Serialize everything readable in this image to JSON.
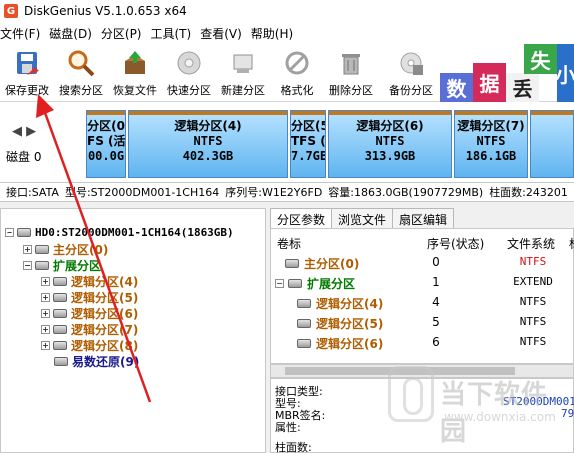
{
  "window": {
    "title": "DiskGenius V5.1.0.653 x64",
    "app_icon_letter": "G"
  },
  "menu": [
    "文件(F)",
    "磁盘(D)",
    "分区(P)",
    "工具(T)",
    "查看(V)",
    "帮助(H)"
  ],
  "toolbar": [
    {
      "label": "保存更改",
      "icon": "save-disk-icon"
    },
    {
      "label": "搜索分区",
      "icon": "magnifier-icon"
    },
    {
      "label": "恢复文件",
      "icon": "recover-box-icon"
    },
    {
      "label": "快速分区",
      "icon": "quick-partition-icon"
    },
    {
      "label": "新建分区",
      "icon": "new-partition-icon"
    },
    {
      "label": "格式化",
      "icon": "format-icon"
    },
    {
      "label": "删除分区",
      "icon": "trash-icon"
    },
    {
      "label": "备份分区",
      "icon": "backup-icon"
    }
  ],
  "ad_tiles": [
    {
      "text": "数",
      "bg": "#5a6fd6"
    },
    {
      "text": "据",
      "bg": "#d42a5a"
    },
    {
      "text": "丢",
      "bg": "#f2f2f2"
    },
    {
      "text": "失",
      "bg": "#3aa64a"
    },
    {
      "text": "小",
      "bg": "#2a6fc9"
    }
  ],
  "disk_map": {
    "disk_label": "磁盘 0",
    "partitions": [
      {
        "line1": "分区(0",
        "line2": "FS (活",
        "line3": "00.0G"
      },
      {
        "line1": "逻辑分区(4)",
        "line2": "NTFS",
        "line3": "402.3GB"
      },
      {
        "line1": "分区(5",
        "line2": "TFS (隐",
        "line3": "7.7GE"
      },
      {
        "line1": "逻辑分区(6)",
        "line2": "NTFS",
        "line3": "313.9GB"
      },
      {
        "line1": "逻辑分区(7)",
        "line2": "NTFS",
        "line3": "186.1GB"
      },
      {
        "line1": "",
        "line2": "",
        "line3": ""
      }
    ]
  },
  "info_bar": {
    "interface": "接口:SATA",
    "model": "型号:ST2000DM001-1CH164",
    "serial": "序列号:W1E2Y6FD",
    "capacity": "容量:1863.0GB(1907729MB)",
    "cylinders": "柱面数:243201"
  },
  "tree": {
    "root": "HD0:ST2000DM001-1CH164(1863GB)",
    "items": [
      {
        "label": "主分区(0)",
        "style": "brown"
      },
      {
        "label": "扩展分区",
        "style": "green"
      },
      {
        "label": "逻辑分区(4)",
        "style": "brown"
      },
      {
        "label": "逻辑分区(5)",
        "style": "brown"
      },
      {
        "label": "逻辑分区(6)",
        "style": "brown"
      },
      {
        "label": "逻辑分区(7)",
        "style": "brown"
      },
      {
        "label": "逻辑分区(8)",
        "style": "brown"
      },
      {
        "label": "易数还原(9)",
        "style": "blue"
      }
    ]
  },
  "tabs": [
    "分区参数",
    "浏览文件",
    "扇区编辑"
  ],
  "partition_table": {
    "headers": [
      "卷标",
      "序号(状态)",
      "文件系统",
      "标"
    ],
    "rows": [
      {
        "label": "主分区(0)",
        "index": "0",
        "fs": "NTFS",
        "style": "brown",
        "fs_red": true
      },
      {
        "label": "扩展分区",
        "index": "1",
        "fs": "EXTEND",
        "style": "green",
        "fs_red": false
      },
      {
        "label": "逻辑分区(4)",
        "index": "4",
        "fs": "NTFS",
        "style": "brown",
        "fs_red": false
      },
      {
        "label": "逻辑分区(5)",
        "index": "5",
        "fs": "NTFS",
        "style": "brown",
        "fs_red": false
      },
      {
        "label": "逻辑分区(6)",
        "index": "6",
        "fs": "NTFS",
        "style": "brown",
        "fs_red": false
      }
    ]
  },
  "details": {
    "interface_type": "接口类型:",
    "model": "型号:",
    "model_value": "ST2000DM001-",
    "mbr_sig": "MBR签名:",
    "mbr_value": "79",
    "attributes": "属性:",
    "cylinders": "柱面数:"
  },
  "watermark": {
    "brand": "当下软件园",
    "url": "www.downxia.com"
  }
}
